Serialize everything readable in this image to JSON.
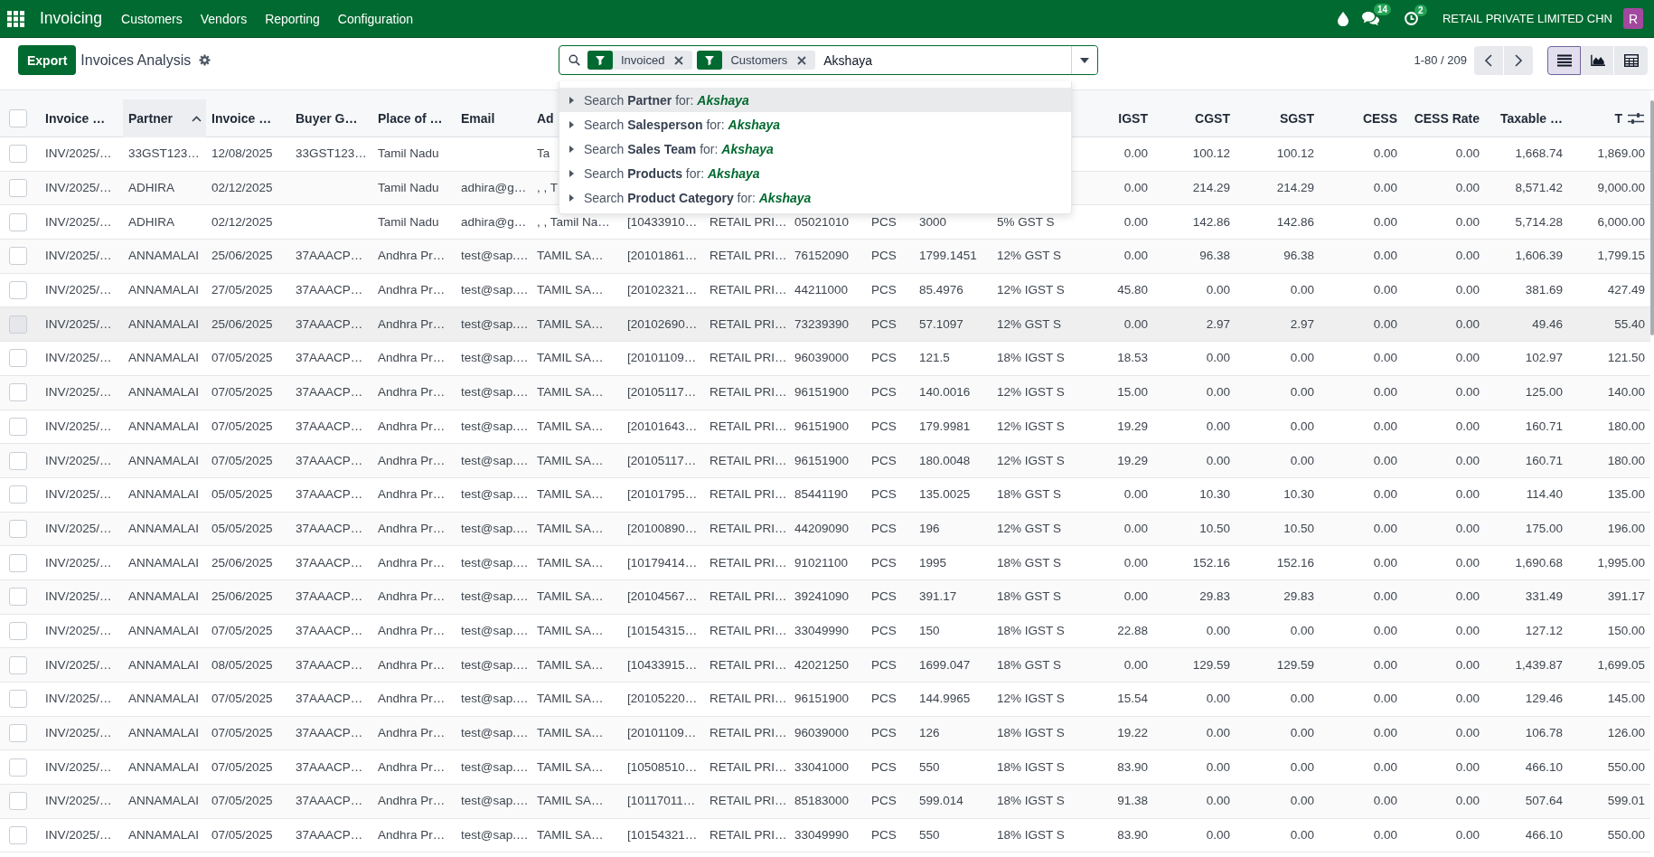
{
  "navbar": {
    "app": "Invoicing",
    "menu": [
      "Customers",
      "Vendors",
      "Reporting",
      "Configuration"
    ],
    "systray": [
      {
        "kind": "drop"
      },
      {
        "kind": "chat",
        "badge": "14"
      },
      {
        "kind": "activity",
        "badge": "2"
      }
    ],
    "company": "RETAIL PRIVATE LIMITED CHN",
    "avatar": "R"
  },
  "control_panel": {
    "export": "Export",
    "title": "Invoices Analysis",
    "search": {
      "facets": [
        {
          "label": "Invoiced"
        },
        {
          "label": "Customers"
        }
      ],
      "value": "Akshaya"
    },
    "pager": "1-80 / 209",
    "views": [
      {
        "kind": "list",
        "selected": true
      },
      {
        "kind": "graph",
        "selected": false
      },
      {
        "kind": "pivot",
        "selected": false
      }
    ]
  },
  "search_dropdown": {
    "items": [
      {
        "label": "Search **Partner** for:",
        "value": "Akshaya",
        "selected": true
      },
      {
        "label": "Search **Salesperson** for:",
        "value": "Akshaya",
        "selected": false
      },
      {
        "label": "Search **Sales Team** for:",
        "value": "Akshaya",
        "selected": false
      },
      {
        "label": "Search **Products** for:",
        "value": "Akshaya",
        "selected": false
      },
      {
        "label": "Search **Product Category** for:",
        "value": "Akshaya",
        "selected": false
      }
    ]
  },
  "table": {
    "select_all": {
      "checked": false
    },
    "columns": [
      {
        "label": "Invoice …",
        "kind": "text",
        "sorted": false
      },
      {
        "label": "Partner",
        "kind": "text",
        "sorted": true
      },
      {
        "label": "Invoice …",
        "kind": "text",
        "sorted": false
      },
      {
        "label": "Buyer G…",
        "kind": "text",
        "sorted": false
      },
      {
        "label": "Place of …",
        "kind": "text",
        "sorted": false
      },
      {
        "label": "Email",
        "kind": "text",
        "sorted": false
      },
      {
        "label": "Ad",
        "kind": "text",
        "sorted": false
      },
      {
        "kind": "text"
      },
      {
        "kind": "text"
      },
      {
        "kind": "text"
      },
      {
        "kind": "text"
      },
      {
        "kind": "text"
      },
      {
        "kind": "text"
      },
      {
        "label": "IGST",
        "kind": "number",
        "sorted": false
      },
      {
        "label": "CGST",
        "kind": "number",
        "sorted": false
      },
      {
        "label": "SGST",
        "kind": "number",
        "sorted": false
      },
      {
        "label": "CESS",
        "kind": "number",
        "sorted": false
      },
      {
        "label": "CESS Rate",
        "kind": "number",
        "sorted": false
      },
      {
        "label": "Taxable …",
        "kind": "number",
        "sorted": false
      },
      {
        "label": "T",
        "kind": "number",
        "sorted": false
      }
    ],
    "rows": [
      {
        "checked": false,
        "highlighted": false,
        "cells": [
          "INV/2025/…",
          "33GST123…",
          "12/08/2025",
          "33GST123…",
          "Tamil Nadu",
          null,
          "Ta",
          null,
          null,
          null,
          null,
          null,
          null,
          "0.00",
          "100.12",
          "100.12",
          "0.00",
          "0.00",
          "1,668.74",
          "1,869.00"
        ]
      },
      {
        "checked": false,
        "highlighted": false,
        "cells": [
          "INV/2025/…",
          "ADHIRA",
          "02/12/2025",
          null,
          "Tamil Nadu",
          "adhira@g…",
          ", , T",
          null,
          null,
          null,
          null,
          null,
          null,
          "0.00",
          "214.29",
          "214.29",
          "0.00",
          "0.00",
          "8,571.42",
          "9,000.00"
        ]
      },
      {
        "checked": false,
        "highlighted": false,
        "cells": [
          "INV/2025/…",
          "ADHIRA",
          "02/12/2025",
          null,
          "Tamil Nadu",
          "adhira@g…",
          ", , Tamil Na…",
          "[10433910…",
          "RETAIL PRI…",
          "05021010",
          "PCS",
          "3000",
          "5% GST S",
          "0.00",
          "142.86",
          "142.86",
          "0.00",
          "0.00",
          "5,714.28",
          "6,000.00"
        ]
      },
      {
        "checked": false,
        "highlighted": false,
        "cells": [
          "INV/2025/…",
          "ANNAMALAI",
          "25/06/2025",
          "37AAACP…",
          "Andhra Pr…",
          "test@sap.…",
          "TAMIL SA…",
          "[20101861…",
          "RETAIL PRI…",
          "76152090",
          "PCS",
          "1799.1451",
          "12% GST S",
          "0.00",
          "96.38",
          "96.38",
          "0.00",
          "0.00",
          "1,606.39",
          "1,799.15"
        ]
      },
      {
        "checked": false,
        "highlighted": false,
        "cells": [
          "INV/2025/…",
          "ANNAMALAI",
          "27/05/2025",
          "37AAACP…",
          "Andhra Pr…",
          "test@sap.…",
          "TAMIL SA…",
          "[20102321…",
          "RETAIL PRI…",
          "44211000",
          "PCS",
          "85.4976",
          "12% IGST S",
          "45.80",
          "0.00",
          "0.00",
          "0.00",
          "0.00",
          "381.69",
          "427.49"
        ]
      },
      {
        "checked": false,
        "highlighted": true,
        "cells": [
          "INV/2025/…",
          "ANNAMALAI",
          "25/06/2025",
          "37AAACP…",
          "Andhra Pr…",
          "test@sap.…",
          "TAMIL SA…",
          "[20102690…",
          "RETAIL PRI…",
          "73239390",
          "PCS",
          "57.1097",
          "12% GST S",
          "0.00",
          "2.97",
          "2.97",
          "0.00",
          "0.00",
          "49.46",
          "55.40"
        ]
      },
      {
        "checked": false,
        "highlighted": false,
        "cells": [
          "INV/2025/…",
          "ANNAMALAI",
          "07/05/2025",
          "37AAACP…",
          "Andhra Pr…",
          "test@sap.…",
          "TAMIL SA…",
          "[20101109…",
          "RETAIL PRI…",
          "96039000",
          "PCS",
          "121.5",
          "18% IGST S",
          "18.53",
          "0.00",
          "0.00",
          "0.00",
          "0.00",
          "102.97",
          "121.50"
        ]
      },
      {
        "checked": false,
        "highlighted": false,
        "cells": [
          "INV/2025/…",
          "ANNAMALAI",
          "07/05/2025",
          "37AAACP…",
          "Andhra Pr…",
          "test@sap.…",
          "TAMIL SA…",
          "[20105117…",
          "RETAIL PRI…",
          "96151900",
          "PCS",
          "140.0016",
          "12% IGST S",
          "15.00",
          "0.00",
          "0.00",
          "0.00",
          "0.00",
          "125.00",
          "140.00"
        ]
      },
      {
        "checked": false,
        "highlighted": false,
        "cells": [
          "INV/2025/…",
          "ANNAMALAI",
          "07/05/2025",
          "37AAACP…",
          "Andhra Pr…",
          "test@sap.…",
          "TAMIL SA…",
          "[20101643…",
          "RETAIL PRI…",
          "96151900",
          "PCS",
          "179.9981",
          "12% IGST S",
          "19.29",
          "0.00",
          "0.00",
          "0.00",
          "0.00",
          "160.71",
          "180.00"
        ]
      },
      {
        "checked": false,
        "highlighted": false,
        "cells": [
          "INV/2025/…",
          "ANNAMALAI",
          "07/05/2025",
          "37AAACP…",
          "Andhra Pr…",
          "test@sap.…",
          "TAMIL SA…",
          "[20105117…",
          "RETAIL PRI…",
          "96151900",
          "PCS",
          "180.0048",
          "12% IGST S",
          "19.29",
          "0.00",
          "0.00",
          "0.00",
          "0.00",
          "160.71",
          "180.00"
        ]
      },
      {
        "checked": false,
        "highlighted": false,
        "cells": [
          "INV/2025/…",
          "ANNAMALAI",
          "05/05/2025",
          "37AAACP…",
          "Andhra Pr…",
          "test@sap.…",
          "TAMIL SA…",
          "[20101795…",
          "RETAIL PRI…",
          "85441190",
          "PCS",
          "135.0025",
          "18% GST S",
          "0.00",
          "10.30",
          "10.30",
          "0.00",
          "0.00",
          "114.40",
          "135.00"
        ]
      },
      {
        "checked": false,
        "highlighted": false,
        "cells": [
          "INV/2025/…",
          "ANNAMALAI",
          "05/05/2025",
          "37AAACP…",
          "Andhra Pr…",
          "test@sap.…",
          "TAMIL SA…",
          "[20100890…",
          "RETAIL PRI…",
          "44209090",
          "PCS",
          "196",
          "12% GST S",
          "0.00",
          "10.50",
          "10.50",
          "0.00",
          "0.00",
          "175.00",
          "196.00"
        ]
      },
      {
        "checked": false,
        "highlighted": false,
        "cells": [
          "INV/2025/…",
          "ANNAMALAI",
          "25/06/2025",
          "37AAACP…",
          "Andhra Pr…",
          "test@sap.…",
          "TAMIL SA…",
          "[10179414…",
          "RETAIL PRI…",
          "91021100",
          "PCS",
          "1995",
          "18% GST S",
          "0.00",
          "152.16",
          "152.16",
          "0.00",
          "0.00",
          "1,690.68",
          "1,995.00"
        ]
      },
      {
        "checked": false,
        "highlighted": false,
        "cells": [
          "INV/2025/…",
          "ANNAMALAI",
          "25/06/2025",
          "37AAACP…",
          "Andhra Pr…",
          "test@sap.…",
          "TAMIL SA…",
          "[20104567…",
          "RETAIL PRI…",
          "39241090",
          "PCS",
          "391.17",
          "18% GST S",
          "0.00",
          "29.83",
          "29.83",
          "0.00",
          "0.00",
          "331.49",
          "391.17"
        ]
      },
      {
        "checked": false,
        "highlighted": false,
        "cells": [
          "INV/2025/…",
          "ANNAMALAI",
          "07/05/2025",
          "37AAACP…",
          "Andhra Pr…",
          "test@sap.…",
          "TAMIL SA…",
          "[10154315…",
          "RETAIL PRI…",
          "33049990",
          "PCS",
          "150",
          "18% IGST S",
          "22.88",
          "0.00",
          "0.00",
          "0.00",
          "0.00",
          "127.12",
          "150.00"
        ]
      },
      {
        "checked": false,
        "highlighted": false,
        "cells": [
          "INV/2025/…",
          "ANNAMALAI",
          "08/05/2025",
          "37AAACP…",
          "Andhra Pr…",
          "test@sap.…",
          "TAMIL SA…",
          "[10433915…",
          "RETAIL PRI…",
          "42021250",
          "PCS",
          "1699.047",
          "18% GST S",
          "0.00",
          "129.59",
          "129.59",
          "0.00",
          "0.00",
          "1,439.87",
          "1,699.05"
        ]
      },
      {
        "checked": false,
        "highlighted": false,
        "cells": [
          "INV/2025/…",
          "ANNAMALAI",
          "07/05/2025",
          "37AAACP…",
          "Andhra Pr…",
          "test@sap.…",
          "TAMIL SA…",
          "[20105220…",
          "RETAIL PRI…",
          "96151900",
          "PCS",
          "144.9965",
          "12% IGST S",
          "15.54",
          "0.00",
          "0.00",
          "0.00",
          "0.00",
          "129.46",
          "145.00"
        ]
      },
      {
        "checked": false,
        "highlighted": false,
        "cells": [
          "INV/2025/…",
          "ANNAMALAI",
          "07/05/2025",
          "37AAACP…",
          "Andhra Pr…",
          "test@sap.…",
          "TAMIL SA…",
          "[20101109…",
          "RETAIL PRI…",
          "96039000",
          "PCS",
          "126",
          "18% IGST S",
          "19.22",
          "0.00",
          "0.00",
          "0.00",
          "0.00",
          "106.78",
          "126.00"
        ]
      },
      {
        "checked": false,
        "highlighted": false,
        "cells": [
          "INV/2025/…",
          "ANNAMALAI",
          "07/05/2025",
          "37AAACP…",
          "Andhra Pr…",
          "test@sap.…",
          "TAMIL SA…",
          "[10508510…",
          "RETAIL PRI…",
          "33041000",
          "PCS",
          "550",
          "18% IGST S",
          "83.90",
          "0.00",
          "0.00",
          "0.00",
          "0.00",
          "466.10",
          "550.00"
        ]
      },
      {
        "checked": false,
        "highlighted": false,
        "cells": [
          "INV/2025/…",
          "ANNAMALAI",
          "07/05/2025",
          "37AAACP…",
          "Andhra Pr…",
          "test@sap.…",
          "TAMIL SA…",
          "[10117011…",
          "RETAIL PRI…",
          "85183000",
          "PCS",
          "599.014",
          "18% IGST S",
          "91.38",
          "0.00",
          "0.00",
          "0.00",
          "0.00",
          "507.64",
          "599.01"
        ]
      },
      {
        "checked": false,
        "highlighted": false,
        "cells": [
          "INV/2025/…",
          "ANNAMALAI",
          "07/05/2025",
          "37AAACP…",
          "Andhra Pr…",
          "test@sap.…",
          "TAMIL SA…",
          "[10154321…",
          "RETAIL PRI…",
          "33049990",
          "PCS",
          "550",
          "18% IGST S",
          "83.90",
          "0.00",
          "0.00",
          "0.00",
          "0.00",
          "466.10",
          "550.00"
        ]
      }
    ]
  }
}
